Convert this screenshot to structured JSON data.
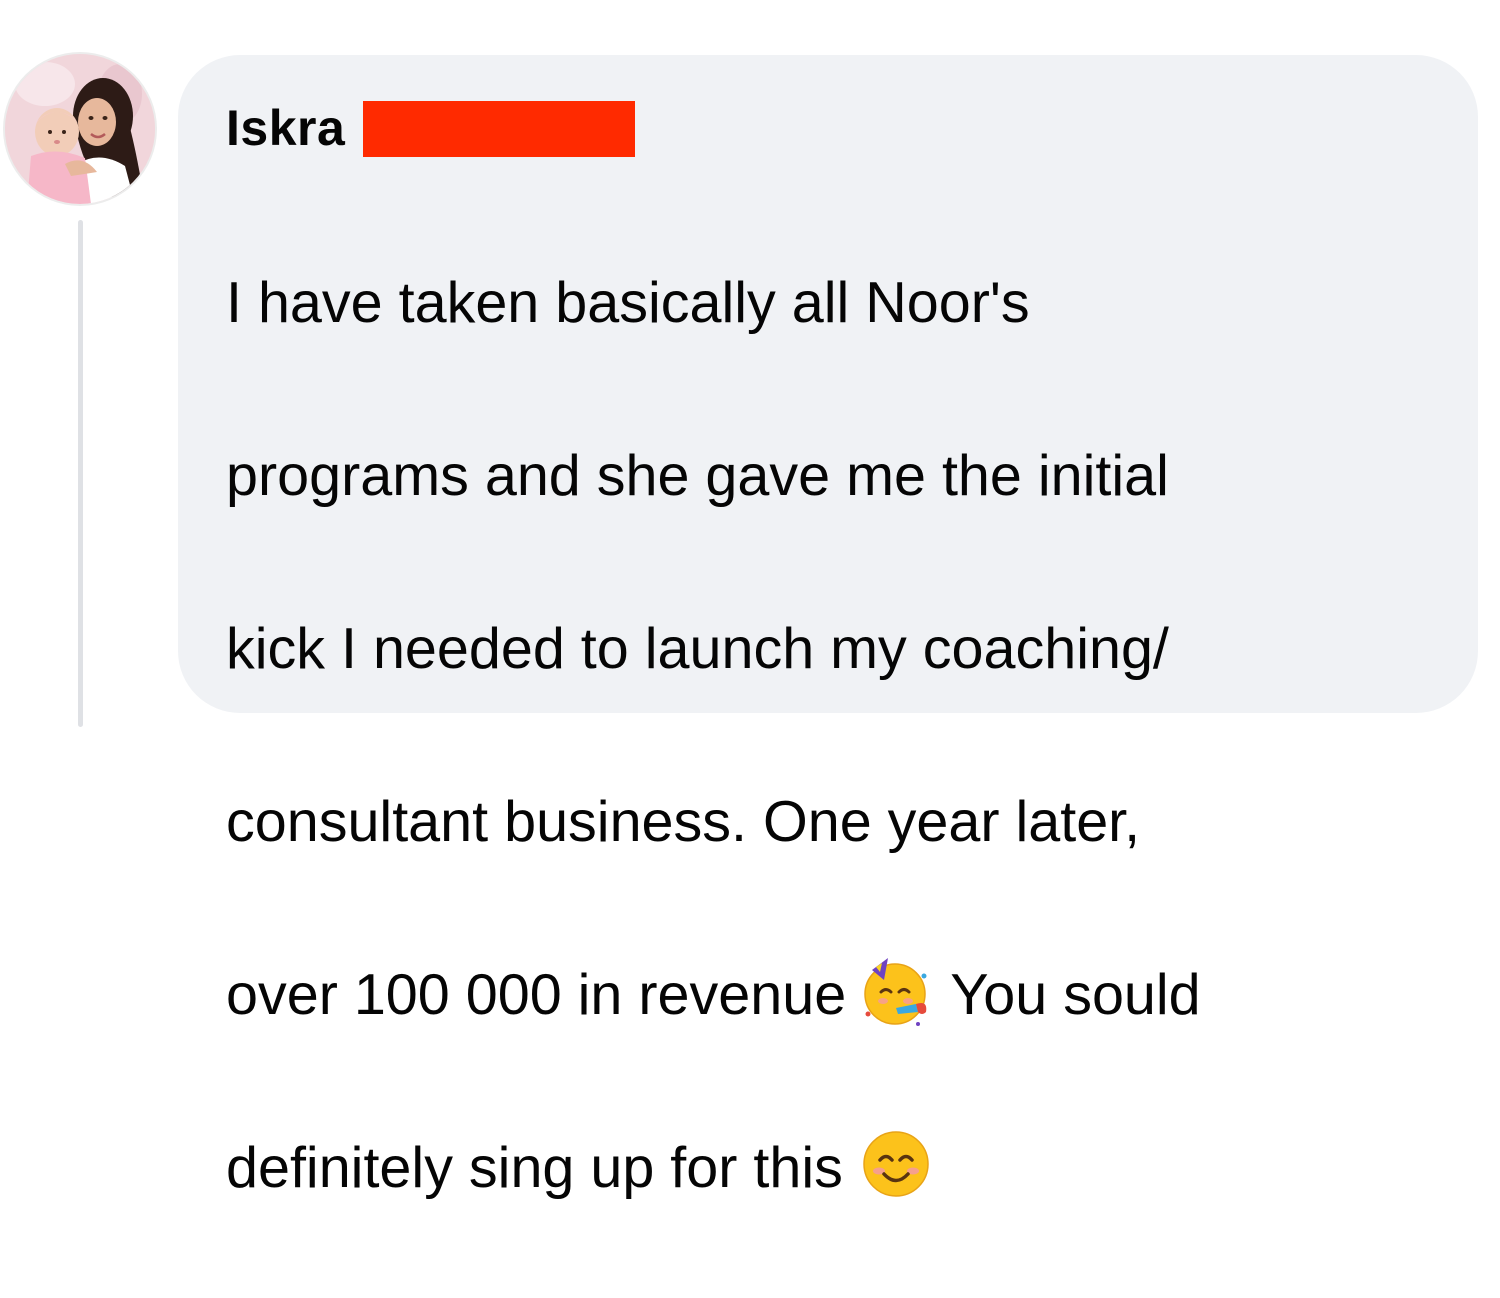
{
  "comment": {
    "author_name": "Iskra",
    "author_surname_redacted": true,
    "lines": [
      "I have taken basically all Noor's",
      "programs and she gave me the initial",
      "kick I needed to launch my coaching/",
      "consultant business. One year later,"
    ],
    "line5_before_emoji": "over 100 000 in revenue",
    "line5_after_emoji": "You sould",
    "line6_before_emoji": "definitely sing up for this",
    "emoji_1": "partying-face",
    "emoji_2": "smiling-face-with-smiling-eyes"
  },
  "colors": {
    "bubble_background": "#f0f2f5",
    "redaction": "#ff2a00",
    "text": "#050505",
    "thread_line": "#dfe1e5"
  }
}
